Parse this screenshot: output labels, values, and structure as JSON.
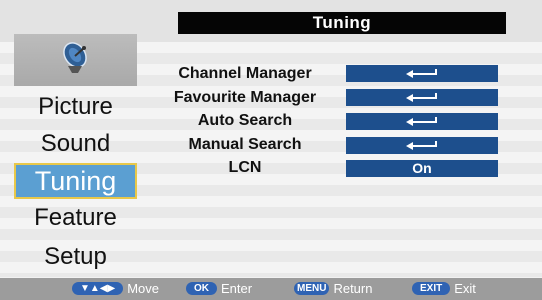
{
  "menu": {
    "title": "Tuning",
    "icon": "satellite-dish-icon",
    "sidebar": [
      {
        "label": "Picture",
        "active": false
      },
      {
        "label": "Sound",
        "active": false
      },
      {
        "label": "Tuning",
        "active": true
      },
      {
        "label": "Feature",
        "active": false
      },
      {
        "label": "Setup",
        "active": false
      }
    ],
    "settings": [
      {
        "label": "Channel Manager",
        "value": "",
        "icon": "enter-arrow-icon"
      },
      {
        "label": "Favourite Manager",
        "value": "",
        "icon": "enter-arrow-icon"
      },
      {
        "label": "Auto Search",
        "value": "",
        "icon": "enter-arrow-icon"
      },
      {
        "label": "Manual Search",
        "value": "",
        "icon": "enter-arrow-icon"
      },
      {
        "label": "LCN",
        "value": "On",
        "icon": ""
      }
    ],
    "footer": {
      "move_key": "▼▲◀▶",
      "move": "Move",
      "ok_key": "OK",
      "enter": "Enter",
      "menu_key": "MENU",
      "return": "Return",
      "exit_key": "EXIT",
      "exit": "Exit"
    }
  },
  "colors": {
    "highlight": "#5b9fd2",
    "highlight_border": "#e8c84a",
    "value_box": "#1d4f8d",
    "footer_bg": "#9c9c9c",
    "footer_keys": "#2f63b3"
  }
}
